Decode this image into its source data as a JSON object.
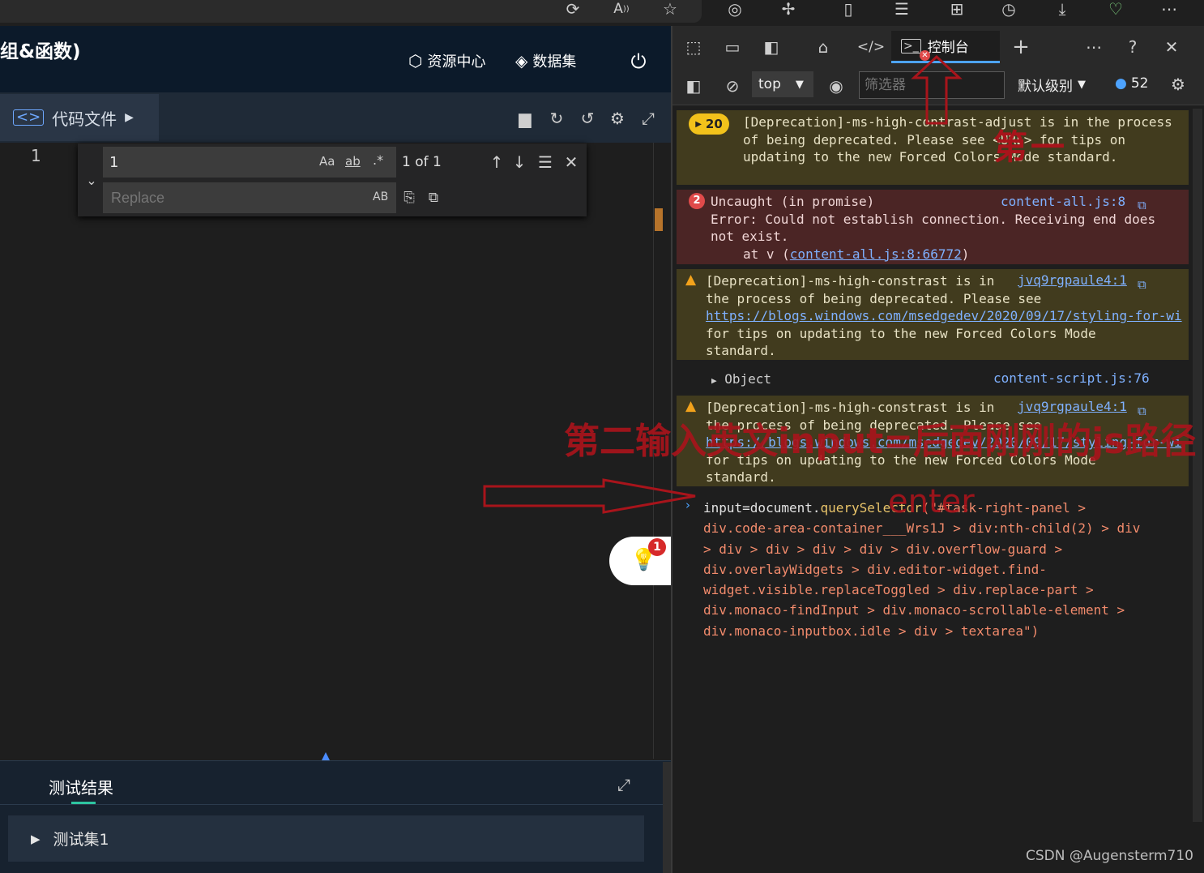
{
  "app": {
    "title": "组&函数)",
    "resource_center": "资源中心",
    "dataset": "数据集",
    "file_tab": "代码文件"
  },
  "editor": {
    "line_number": "1",
    "find_value": "1",
    "find_opts": [
      "Aa",
      "ab",
      ".*"
    ],
    "find_count": "1 of 1",
    "replace_placeholder": "Replace",
    "replace_opt": "AB"
  },
  "results": {
    "title": "测试结果",
    "suite": "测试集1"
  },
  "notification_badge": "1",
  "devtools": {
    "console_tab": "控制台",
    "context": "top",
    "filter_placeholder": "筛选器",
    "level": "默认级别",
    "message_count": "52",
    "messages": [
      {
        "count": "20",
        "text": "[Deprecation]-ms-high-contrast-adjust is in the process of being deprecated. Please see <URL> for tips on updating to the new Forced Colors Mode standard."
      },
      {
        "count": "2",
        "line1": "Uncaught (in promise)",
        "source": "content-all.js:8",
        "line2": "Error: Could not establish connection. Receiving end does not exist.",
        "at": "at v (",
        "at_link": "content-all.js:8:66772",
        "at_end": ")"
      },
      {
        "line1": "[Deprecation]-ms-high-constrast is in",
        "source": "jvq9rgpaule4:1",
        "line2": "the process of being deprecated. Please see",
        "url": "https://blogs.windows.com/msedgedev/2020/09/17/styling-for-wi",
        "line3": "for tips on updating to the new Forced Colors Mode",
        "line4": "standard."
      },
      {
        "object": "Object",
        "source": "content-script.js:76"
      },
      {
        "line1": "[Deprecation]-ms-high-constrast is in",
        "source": "jvq9rgpaule4:1",
        "line2": "the process of being deprecated. Please see",
        "url": "https://blogs.windows.com/msedgedev/2020/09/17/styling-for-wi",
        "line3": "for tips on updating to the new Forced Colors Mode",
        "line4": "standard."
      }
    ],
    "input_prefix": "input=document.",
    "input_method": "querySelector",
    "input_string_lines": [
      "(\"#task-right-panel >",
      "div.code-area-container___Wrs1J > div:nth-child(2) > div",
      "> div > div > div > div > div.overflow-guard >",
      "div.overlayWidgets > div.editor-widget.find-",
      "widget.visible.replaceToggled > div.replace-part >",
      "div.monaco-findInput > div.monaco-scrollable-element >",
      "div.monaco-inputbox.idle > div > textarea\")"
    ]
  },
  "annotations": {
    "first": "第一",
    "second": "第二输入英文input=后面刚刚的js路径",
    "enter": "enter"
  },
  "watermark": "CSDN @Augensterm710"
}
